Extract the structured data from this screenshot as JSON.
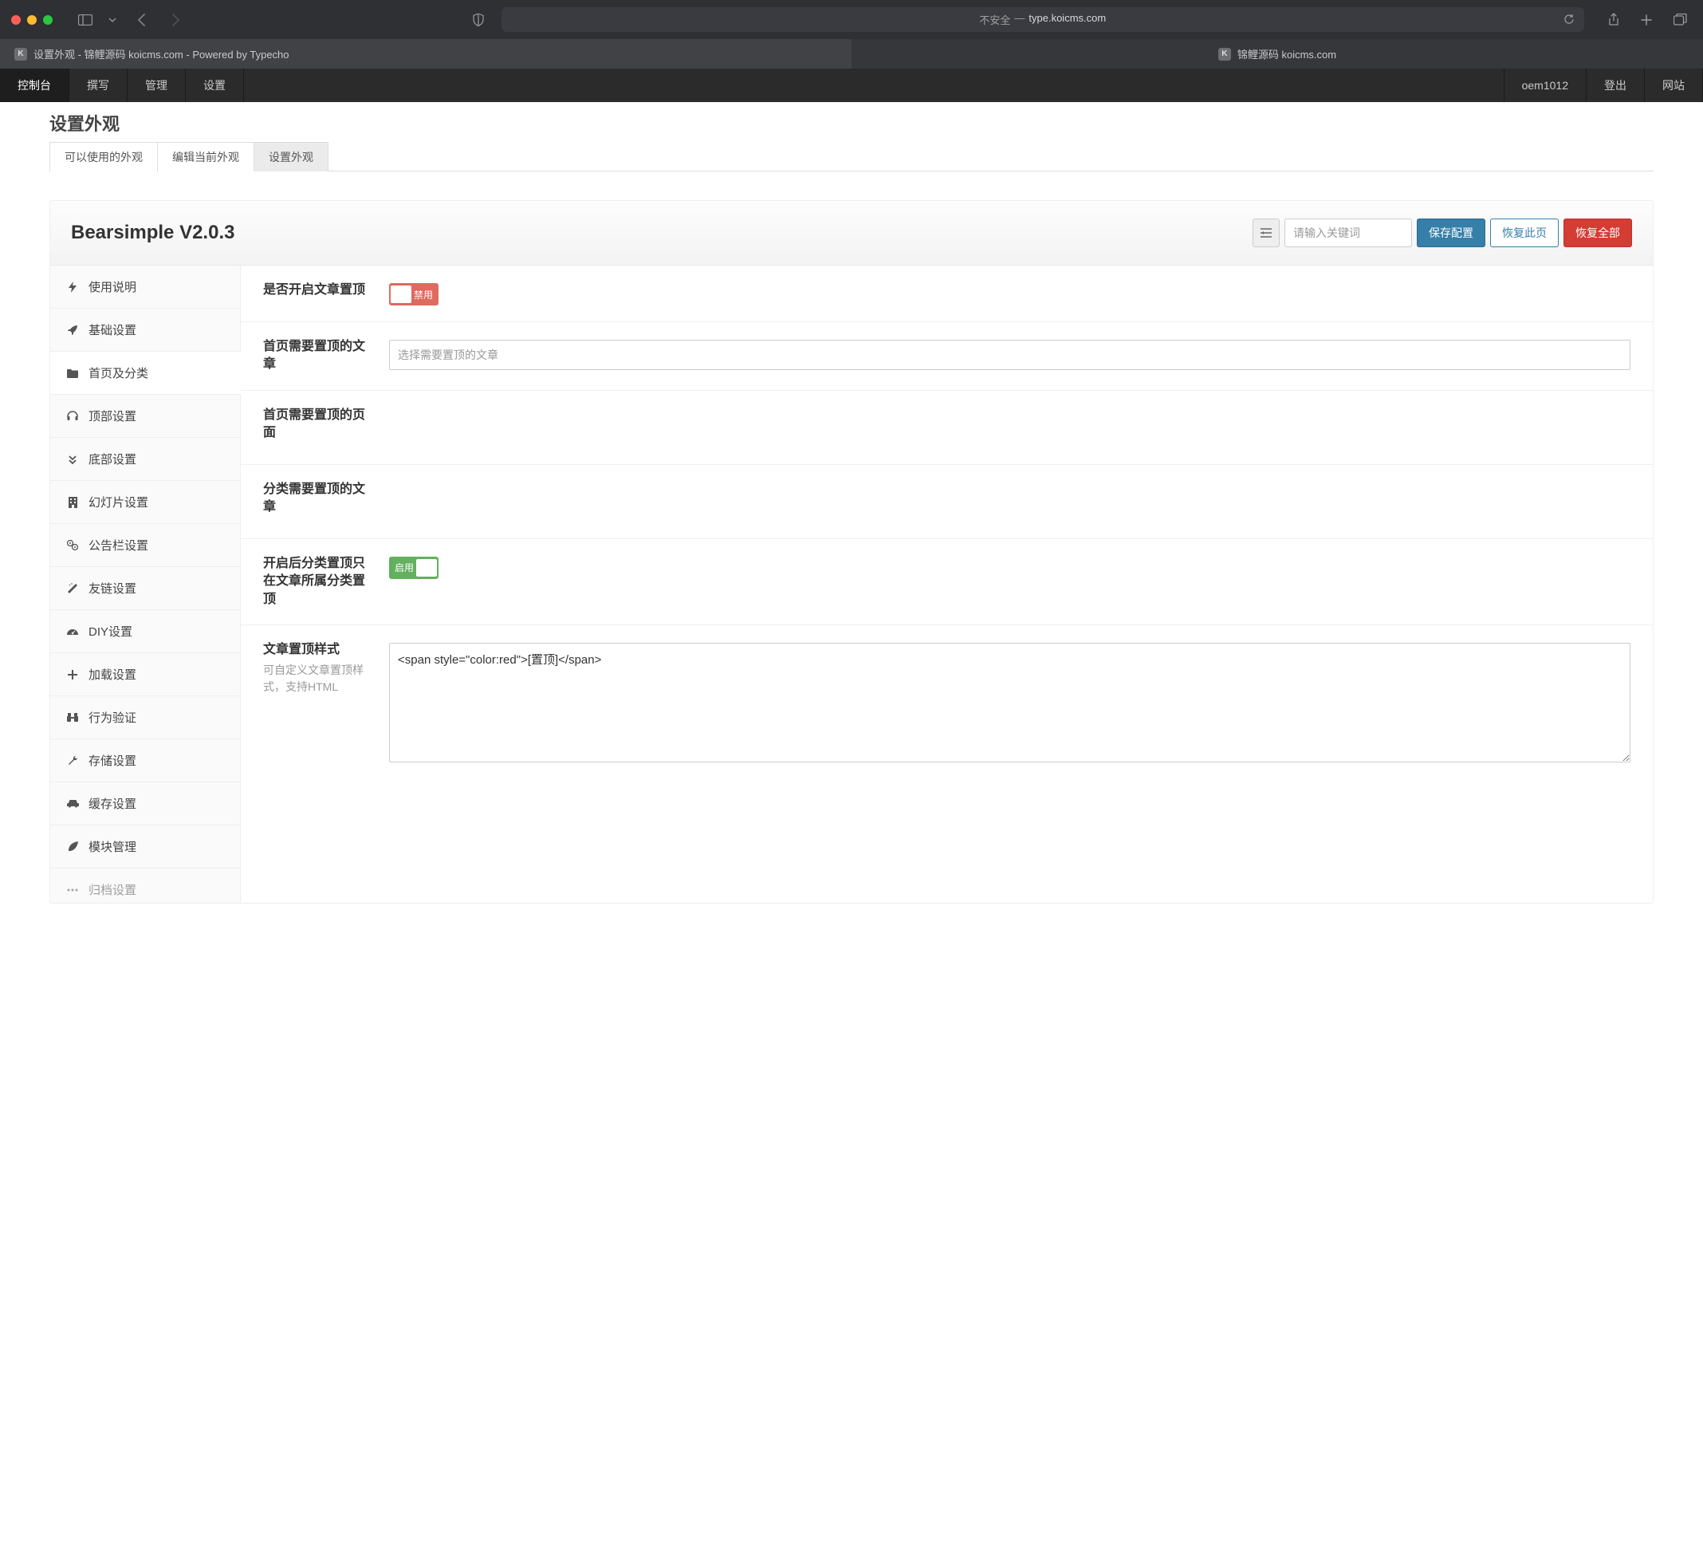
{
  "browser": {
    "address_label": "不安全",
    "address_separator": "—",
    "address_url": "type.koicms.com",
    "tabs": [
      {
        "favicon": "K",
        "title": "设置外观 - 锦鲤源码 koicms.com - Powered by Typecho",
        "active": true
      },
      {
        "favicon": "K",
        "title": "锦鲤源码 koicms.com",
        "active": false
      }
    ]
  },
  "admin_nav": {
    "console": "控制台",
    "items": [
      "撰写",
      "管理",
      "设置"
    ],
    "user": "oem1012",
    "logout": "登出",
    "website": "网站"
  },
  "page": {
    "title": "设置外观",
    "tabs": [
      "可以使用的外观",
      "编辑当前外观",
      "设置外观"
    ],
    "active_tab": 2
  },
  "theme": {
    "title": "Bearsimple V2.0.3",
    "search_placeholder": "请输入关键词",
    "btn_save": "保存配置",
    "btn_restore_page": "恢复此页",
    "btn_restore_all": "恢复全部"
  },
  "sidebar": {
    "items": [
      {
        "icon": "bolt",
        "label": "使用说明"
      },
      {
        "icon": "rocket",
        "label": "基础设置"
      },
      {
        "icon": "folder",
        "label": "首页及分类"
      },
      {
        "icon": "headphones",
        "label": "顶部设置"
      },
      {
        "icon": "chevrons-down",
        "label": "底部设置"
      },
      {
        "icon": "building",
        "label": "幻灯片设置"
      },
      {
        "icon": "gears",
        "label": "公告栏设置"
      },
      {
        "icon": "wand",
        "label": "友链设置"
      },
      {
        "icon": "dashboard",
        "label": "DIY设置"
      },
      {
        "icon": "plus",
        "label": "加载设置"
      },
      {
        "icon": "binoculars",
        "label": "行为验证"
      },
      {
        "icon": "wrench",
        "label": "存储设置"
      },
      {
        "icon": "car",
        "label": "缓存设置"
      },
      {
        "icon": "leaf",
        "label": "模块管理"
      },
      {
        "icon": "more",
        "label": "归档设置"
      }
    ],
    "active": 2
  },
  "form": {
    "row1": {
      "label": "是否开启文章置顶",
      "toggle_text": "禁用",
      "enabled": false
    },
    "row2": {
      "label": "首页需要置顶的文章",
      "placeholder": "选择需要置顶的文章"
    },
    "row3": {
      "label": "首页需要置顶的页面"
    },
    "row4": {
      "label": "分类需要置顶的文章"
    },
    "row5": {
      "label": "开启后分类置顶只在文章所属分类置顶",
      "toggle_text": "启用",
      "enabled": true
    },
    "row6": {
      "label": "文章置顶样式",
      "desc": "可自定义文章置顶样式，支持HTML",
      "value": "<span style=\"color:red\">[置顶]</span>"
    }
  }
}
